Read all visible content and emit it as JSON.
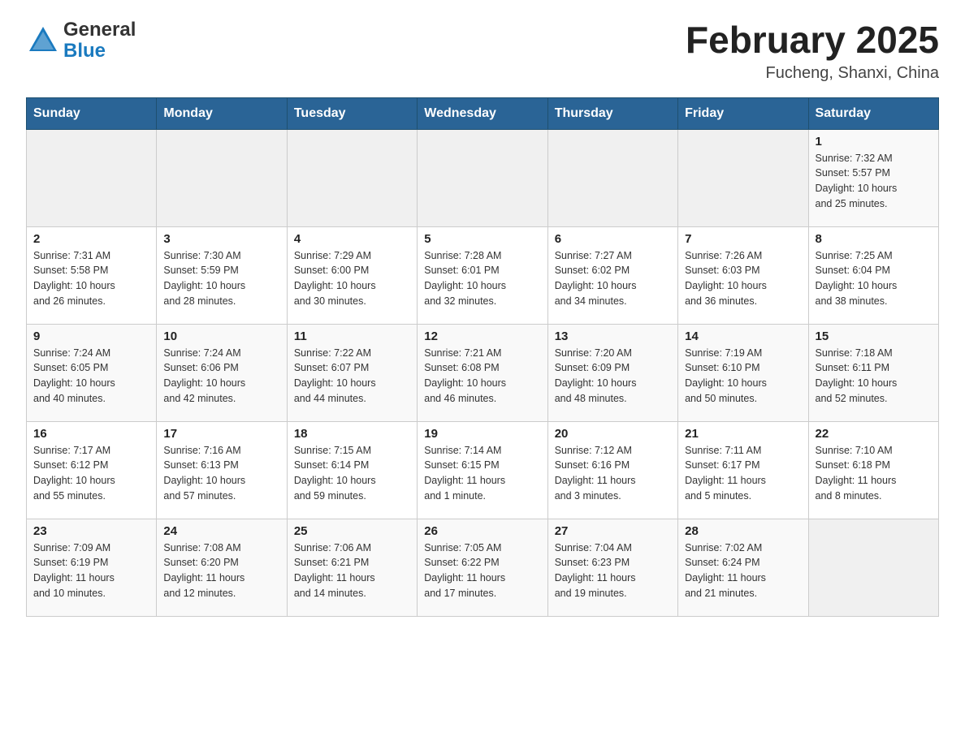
{
  "header": {
    "logo_general": "General",
    "logo_blue": "Blue",
    "title": "February 2025",
    "location": "Fucheng, Shanxi, China"
  },
  "calendar": {
    "days_of_week": [
      "Sunday",
      "Monday",
      "Tuesday",
      "Wednesday",
      "Thursday",
      "Friday",
      "Saturday"
    ],
    "weeks": [
      {
        "cells": [
          {
            "day": "",
            "info": ""
          },
          {
            "day": "",
            "info": ""
          },
          {
            "day": "",
            "info": ""
          },
          {
            "day": "",
            "info": ""
          },
          {
            "day": "",
            "info": ""
          },
          {
            "day": "",
            "info": ""
          },
          {
            "day": "1",
            "info": "Sunrise: 7:32 AM\nSunset: 5:57 PM\nDaylight: 10 hours\nand 25 minutes."
          }
        ]
      },
      {
        "cells": [
          {
            "day": "2",
            "info": "Sunrise: 7:31 AM\nSunset: 5:58 PM\nDaylight: 10 hours\nand 26 minutes."
          },
          {
            "day": "3",
            "info": "Sunrise: 7:30 AM\nSunset: 5:59 PM\nDaylight: 10 hours\nand 28 minutes."
          },
          {
            "day": "4",
            "info": "Sunrise: 7:29 AM\nSunset: 6:00 PM\nDaylight: 10 hours\nand 30 minutes."
          },
          {
            "day": "5",
            "info": "Sunrise: 7:28 AM\nSunset: 6:01 PM\nDaylight: 10 hours\nand 32 minutes."
          },
          {
            "day": "6",
            "info": "Sunrise: 7:27 AM\nSunset: 6:02 PM\nDaylight: 10 hours\nand 34 minutes."
          },
          {
            "day": "7",
            "info": "Sunrise: 7:26 AM\nSunset: 6:03 PM\nDaylight: 10 hours\nand 36 minutes."
          },
          {
            "day": "8",
            "info": "Sunrise: 7:25 AM\nSunset: 6:04 PM\nDaylight: 10 hours\nand 38 minutes."
          }
        ]
      },
      {
        "cells": [
          {
            "day": "9",
            "info": "Sunrise: 7:24 AM\nSunset: 6:05 PM\nDaylight: 10 hours\nand 40 minutes."
          },
          {
            "day": "10",
            "info": "Sunrise: 7:24 AM\nSunset: 6:06 PM\nDaylight: 10 hours\nand 42 minutes."
          },
          {
            "day": "11",
            "info": "Sunrise: 7:22 AM\nSunset: 6:07 PM\nDaylight: 10 hours\nand 44 minutes."
          },
          {
            "day": "12",
            "info": "Sunrise: 7:21 AM\nSunset: 6:08 PM\nDaylight: 10 hours\nand 46 minutes."
          },
          {
            "day": "13",
            "info": "Sunrise: 7:20 AM\nSunset: 6:09 PM\nDaylight: 10 hours\nand 48 minutes."
          },
          {
            "day": "14",
            "info": "Sunrise: 7:19 AM\nSunset: 6:10 PM\nDaylight: 10 hours\nand 50 minutes."
          },
          {
            "day": "15",
            "info": "Sunrise: 7:18 AM\nSunset: 6:11 PM\nDaylight: 10 hours\nand 52 minutes."
          }
        ]
      },
      {
        "cells": [
          {
            "day": "16",
            "info": "Sunrise: 7:17 AM\nSunset: 6:12 PM\nDaylight: 10 hours\nand 55 minutes."
          },
          {
            "day": "17",
            "info": "Sunrise: 7:16 AM\nSunset: 6:13 PM\nDaylight: 10 hours\nand 57 minutes."
          },
          {
            "day": "18",
            "info": "Sunrise: 7:15 AM\nSunset: 6:14 PM\nDaylight: 10 hours\nand 59 minutes."
          },
          {
            "day": "19",
            "info": "Sunrise: 7:14 AM\nSunset: 6:15 PM\nDaylight: 11 hours\nand 1 minute."
          },
          {
            "day": "20",
            "info": "Sunrise: 7:12 AM\nSunset: 6:16 PM\nDaylight: 11 hours\nand 3 minutes."
          },
          {
            "day": "21",
            "info": "Sunrise: 7:11 AM\nSunset: 6:17 PM\nDaylight: 11 hours\nand 5 minutes."
          },
          {
            "day": "22",
            "info": "Sunrise: 7:10 AM\nSunset: 6:18 PM\nDaylight: 11 hours\nand 8 minutes."
          }
        ]
      },
      {
        "cells": [
          {
            "day": "23",
            "info": "Sunrise: 7:09 AM\nSunset: 6:19 PM\nDaylight: 11 hours\nand 10 minutes."
          },
          {
            "day": "24",
            "info": "Sunrise: 7:08 AM\nSunset: 6:20 PM\nDaylight: 11 hours\nand 12 minutes."
          },
          {
            "day": "25",
            "info": "Sunrise: 7:06 AM\nSunset: 6:21 PM\nDaylight: 11 hours\nand 14 minutes."
          },
          {
            "day": "26",
            "info": "Sunrise: 7:05 AM\nSunset: 6:22 PM\nDaylight: 11 hours\nand 17 minutes."
          },
          {
            "day": "27",
            "info": "Sunrise: 7:04 AM\nSunset: 6:23 PM\nDaylight: 11 hours\nand 19 minutes."
          },
          {
            "day": "28",
            "info": "Sunrise: 7:02 AM\nSunset: 6:24 PM\nDaylight: 11 hours\nand 21 minutes."
          },
          {
            "day": "",
            "info": ""
          }
        ]
      }
    ]
  }
}
